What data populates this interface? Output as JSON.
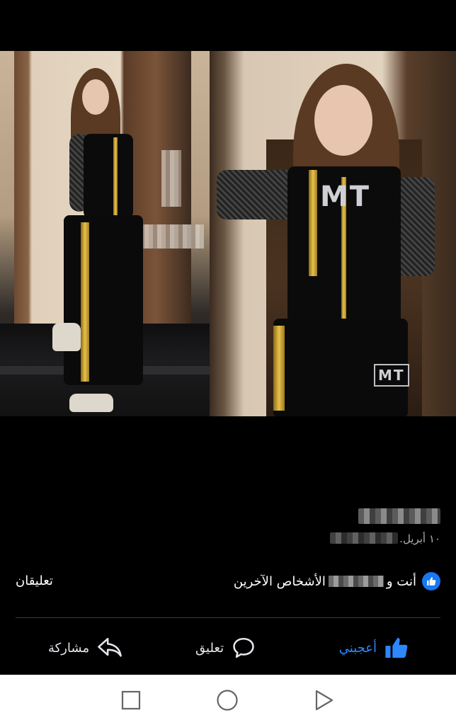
{
  "post": {
    "date": "١٠ أبريل.",
    "reactions_text_prefix": "أنت و",
    "reactions_text_suffix": "الأشخاص الآخرين",
    "comments_count": "تعليقان",
    "photo_logo_top": "MT",
    "photo_logo_bottom": "MT"
  },
  "actions": {
    "like_label": "أعجبني",
    "comment_label": "تعليق",
    "share_label": "مشاركة"
  },
  "colors": {
    "like_blue": "#2d88ff",
    "badge_blue": "#1877f2",
    "background": "#000000",
    "navbar": "#ffffff"
  },
  "icons": {
    "like": "thumbs-up-icon",
    "comment": "speech-bubble-icon",
    "share": "share-arrow-icon",
    "nav_back": "triangle-back-icon",
    "nav_home": "circle-home-icon",
    "nav_recent": "square-recent-icon"
  }
}
